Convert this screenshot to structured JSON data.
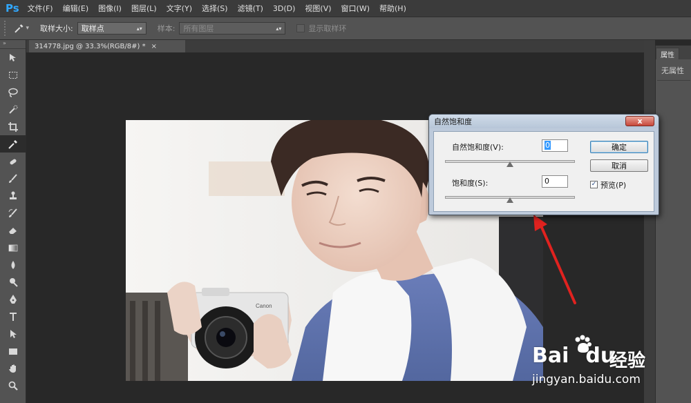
{
  "app": {
    "logo": "Ps"
  },
  "menu": [
    "文件(F)",
    "编辑(E)",
    "图像(I)",
    "图层(L)",
    "文字(Y)",
    "选择(S)",
    "滤镜(T)",
    "3D(D)",
    "视图(V)",
    "窗口(W)",
    "帮助(H)"
  ],
  "options": {
    "sample_size_label": "取样大小:",
    "sample_size_value": "取样点",
    "sample_label": "样本:",
    "sample_value": "所有图层",
    "show_ring_label": "显示取样环"
  },
  "document_tab": {
    "title": "314778.jpg @ 33.3%(RGB/8#) *",
    "close": "×"
  },
  "right_panel": {
    "tab": "属性",
    "content": "无属性"
  },
  "dialog": {
    "title": "自然饱和度",
    "close": "x",
    "vibrance_label": "自然饱和度(V):",
    "vibrance_value": "0",
    "vibrance_level": 0.5,
    "saturation_label": "饱和度(S):",
    "saturation_value": "0",
    "saturation_level": 0.5,
    "ok": "确定",
    "cancel": "取消",
    "preview_label": "预览(P)",
    "preview_checked": true
  },
  "watermark": {
    "brand": "Bai",
    "brand_suffix": "du",
    "product": "经验",
    "url": "jingyan.baidu.com"
  },
  "colors": {
    "ps_blue": "#31a8ff",
    "arrow_red": "#e0221f",
    "shirt_blue": "#5a6fae"
  }
}
